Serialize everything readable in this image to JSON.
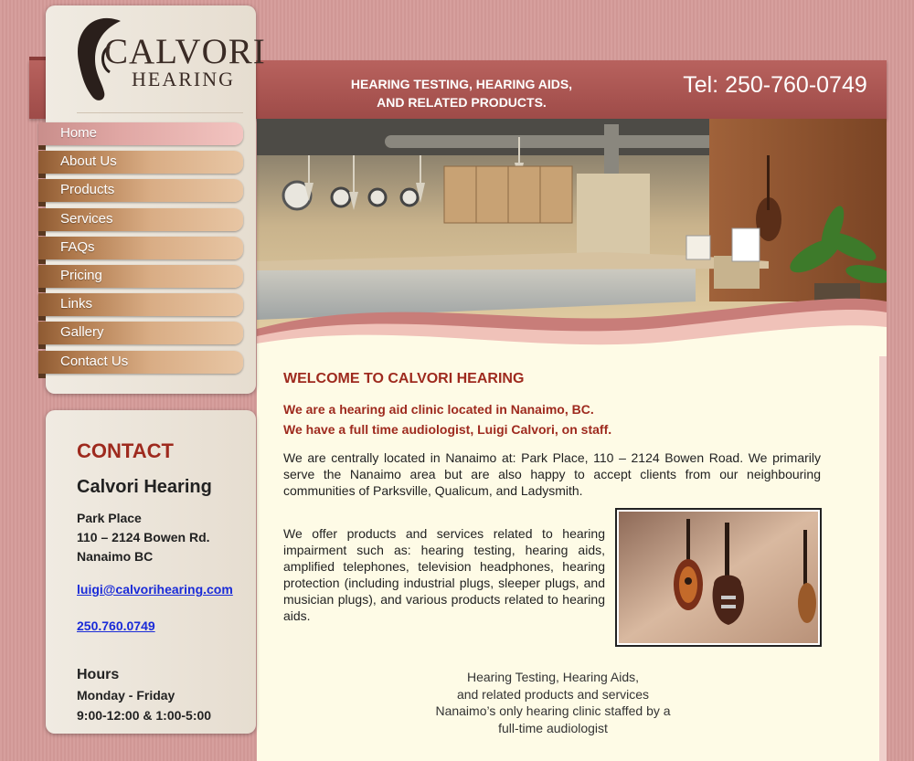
{
  "header": {
    "tagline_line1": "HEARING TESTING, HEARING AIDS,",
    "tagline_line2": "AND RELATED PRODUCTS.",
    "phone": "Tel: 250-760-0749"
  },
  "logo": {
    "name": "CALVORI",
    "sub": "HEARING",
    "icon": "ear-icon"
  },
  "nav": {
    "items": [
      {
        "label": "Home",
        "active": true
      },
      {
        "label": "About Us"
      },
      {
        "label": "Products"
      },
      {
        "label": "Services"
      },
      {
        "label": "FAQs"
      },
      {
        "label": "Pricing"
      },
      {
        "label": "Links"
      },
      {
        "label": "Gallery"
      },
      {
        "label": "Contact Us"
      }
    ]
  },
  "contact": {
    "heading": "CONTACT",
    "name": "Calvori Hearing",
    "address_line1": "Park Place",
    "address_line2": "110 – 2124 Bowen Rd.",
    "address_line3": "Nanaimo BC",
    "email": "luigi@calvorihearing.com",
    "phone": "250.760.0749",
    "hours_heading": "Hours",
    "hours_days": "Monday - Friday",
    "hours_times": "9:00-12:00 & 1:00-5:00"
  },
  "main": {
    "welcome_heading": "WELCOME TO CALVORI HEARING",
    "intro_line1": "We are a hearing aid clinic located in Nanaimo, BC.",
    "intro_line2": "We have a full time audiologist, Luigi Calvori, on staff.",
    "para1": "We are centrally located in Nanaimo at: Park Place, 110 – 2124 Bowen Road. We primarily serve the Nanaimo area but are also happy to accept clients from our neighbouring communities of Parksville, Qualicum, and Ladysmith.",
    "para2": "We offer products and services related to hearing impairment such as: hearing testing, hearing aids, amplified telephones, television headphones, hearing protection (including industrial plugs, sleeper plugs, and musician plugs), and various products related to hearing aids.",
    "footer_line1": "Hearing Testing, Hearing Aids,",
    "footer_line2": "and related products and services",
    "footer_line3": "Nanaimo’s only hearing clinic staffed by a",
    "footer_line4": "full-time audiologist"
  },
  "colors": {
    "brand_red": "#9e2a1e",
    "header_band": "#a95552",
    "page_background": "#d49a98",
    "content_background": "#fefbe6",
    "link": "#1a2bd8"
  }
}
